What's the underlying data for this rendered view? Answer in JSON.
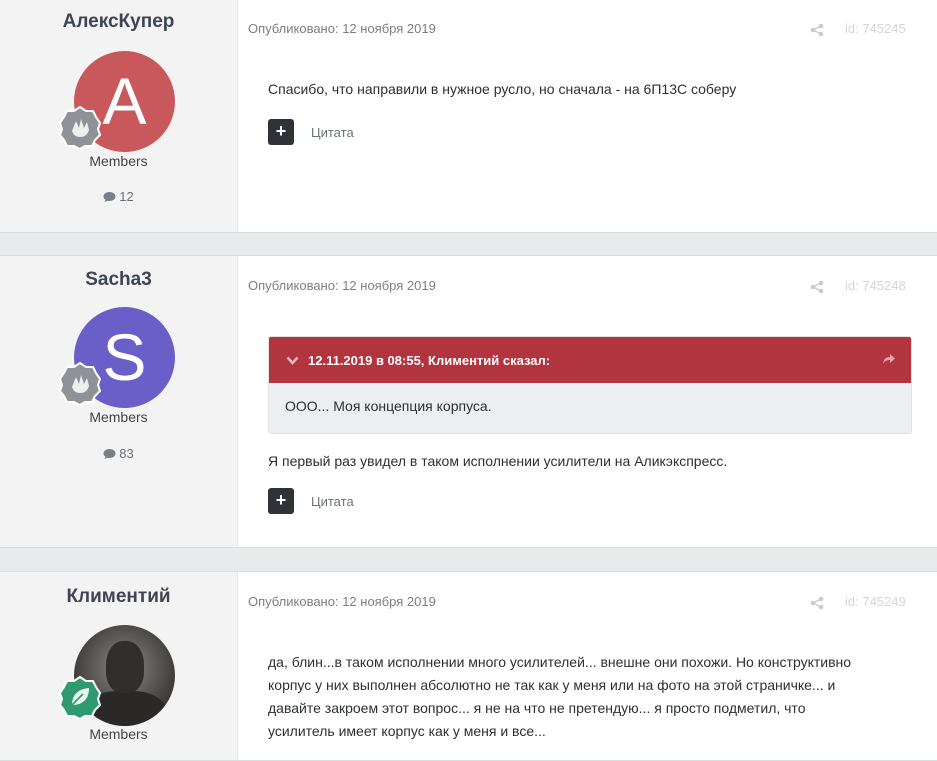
{
  "posts": [
    {
      "author": "АлексКупер",
      "avatar_letter": "A",
      "avatar_color": "#c9585c",
      "badge_icon": "hand-badge-icon",
      "badge_color": "#8f9296",
      "group": "Members",
      "post_count": "12",
      "published": "Опубликовано: 12 ноября 2019",
      "post_id": "id: 745245",
      "body": "Спасибо, что направили в нужное русло, но сначала - на 6П13С соберу",
      "quote_button": "Цитата"
    },
    {
      "author": "Sacha3",
      "avatar_letter": "S",
      "avatar_color": "#6a5fc9",
      "badge_icon": "hand-badge-icon",
      "badge_color": "#8f9296",
      "group": "Members",
      "post_count": "83",
      "published": "Опубликовано: 12 ноября 2019",
      "post_id": "id: 745248",
      "quote": {
        "header": "12.11.2019 в 08:55, Климентий сказал:",
        "text": "ООО... Моя концепция корпуса.",
        "header_color": "#b2343f"
      },
      "body": "Я первый раз увидел в таком исполнении усилители на Аликэкспресс.",
      "quote_button": "Цитата"
    },
    {
      "author": "Климентий",
      "badge_icon": "leaf-badge-icon",
      "badge_color": "#2e9a6f",
      "group": "Members",
      "published": "Опубликовано: 12 ноября 2019",
      "post_id": "id: 745249",
      "body_lines": [
        "да, блин...в таком исполнении много усилителей... внешне они похожи. Но конструктивно",
        "корпус у них выполнен абсолютно не так как у меня или на фото на этой страничке... и",
        "давайте закроем этот вопрос... я не на что не претендую... я просто подметил, что",
        "усилитель имеет корпус как у меня и все..."
      ]
    }
  ]
}
